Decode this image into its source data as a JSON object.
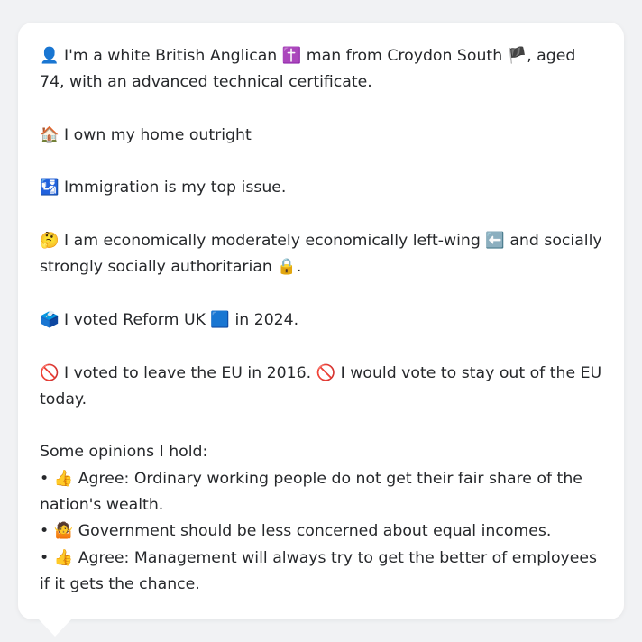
{
  "message": {
    "identity": {
      "icon": "👤",
      "text_a": "I'm a white British Anglican ",
      "icon_religion": "✝️",
      "text_b": " man from Croydon South ",
      "icon_flag": "🏴",
      "text_c": ", aged 74, with an advanced technical certificate."
    },
    "home": {
      "icon": "🏠",
      "text": "I own my home outright"
    },
    "issue": {
      "icon": "🛂",
      "text": "Immigration is my top issue."
    },
    "ideology": {
      "icon": "🤔",
      "text_a": "I am economically moderately economically left-wing ",
      "icon_left": "⬅️",
      "text_b": " and socially strongly socially authoritarian ",
      "icon_lock": "🔒",
      "text_c": "."
    },
    "vote": {
      "icon": "🗳️",
      "text_a": "I voted Reform UK ",
      "icon_party": "🟦",
      "text_b": " in 2024."
    },
    "eu": {
      "icon_a": "🚫",
      "text_a": "I voted to leave the EU in 2016. ",
      "icon_b": "🚫",
      "text_b": "I would vote to stay out of the EU today."
    },
    "opinions": {
      "heading": "Some opinions I hold:",
      "items": [
        {
          "bullet": "•",
          "icon": "👍",
          "text": "Agree: Ordinary working people do not get their fair share of the nation's wealth."
        },
        {
          "bullet": "•",
          "icon": "🤷",
          "text": "Government should be less concerned about equal incomes."
        },
        {
          "bullet": "•",
          "icon": "👍",
          "text": "Agree: Management will always try to get the better of employees if it gets the chance."
        }
      ]
    }
  }
}
